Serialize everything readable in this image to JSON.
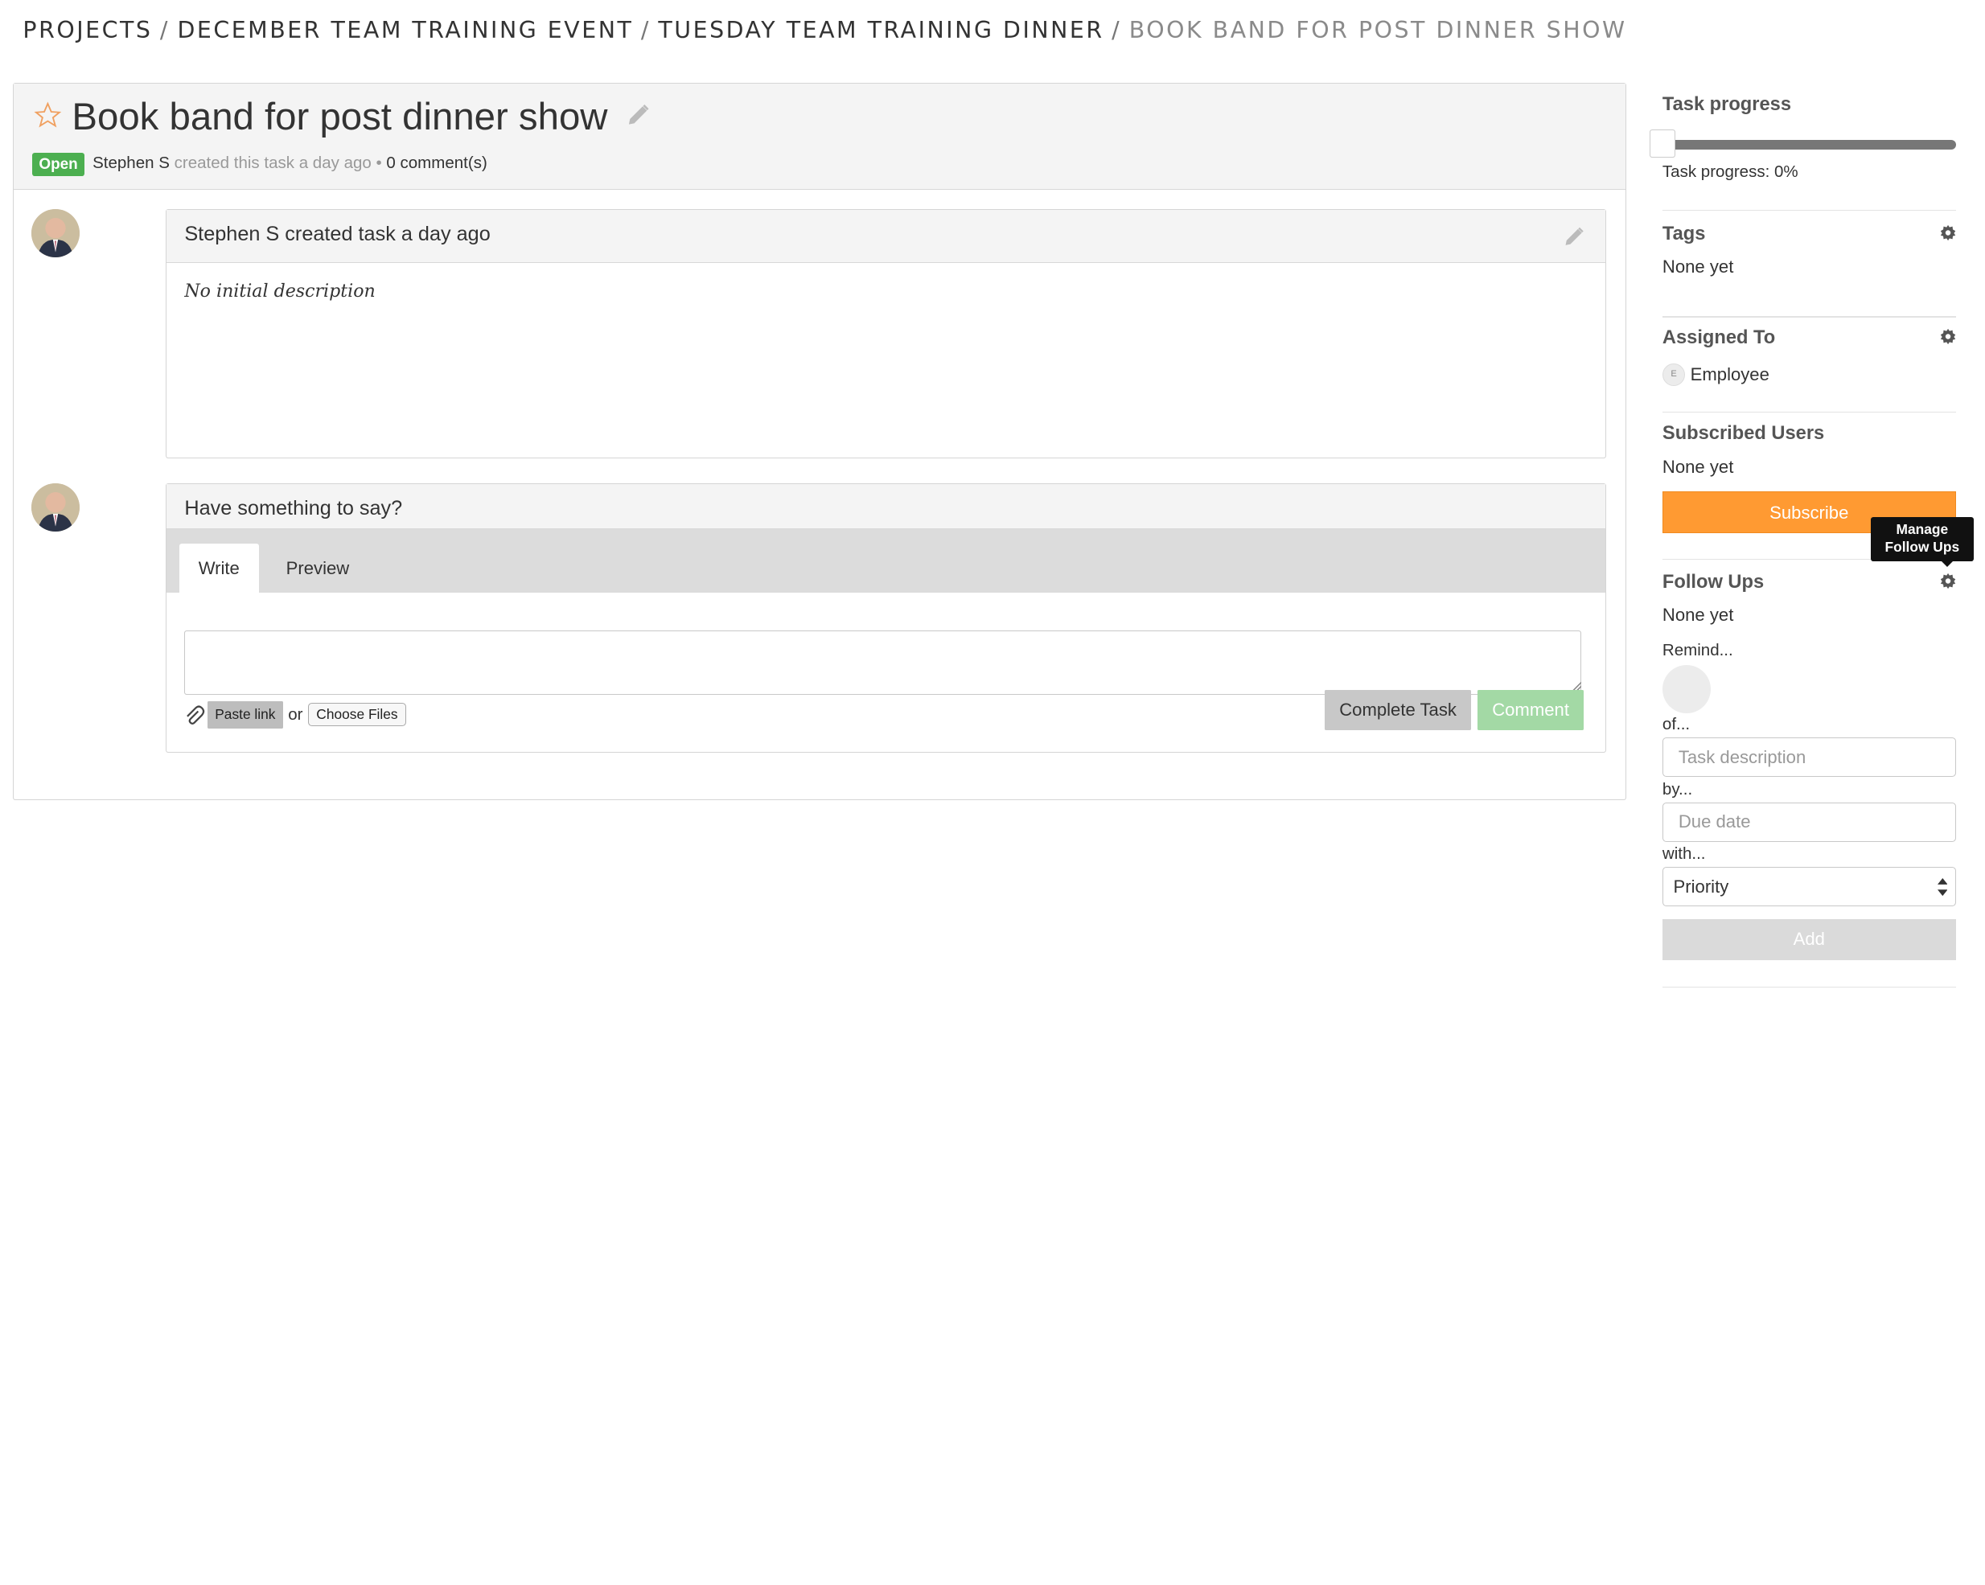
{
  "breadcrumb": {
    "items": [
      "PROJECTS",
      "DECEMBER TEAM TRAINING EVENT",
      "TUESDAY TEAM TRAINING DINNER"
    ],
    "current": "BOOK BAND FOR POST DINNER SHOW",
    "separator": "/"
  },
  "task": {
    "title": "Book band for post dinner show",
    "status": "Open",
    "author": "Stephen S",
    "created_text": "created this task a day ago",
    "dot": "•",
    "comments": "0 comment(s)"
  },
  "activity": {
    "header": "Stephen S created task a day ago",
    "description": "No initial description"
  },
  "comment_form": {
    "header": "Have something to say?",
    "tabs": [
      "Write",
      "Preview"
    ],
    "active_tab": "Write",
    "paste_link": "Paste link",
    "or": "or",
    "choose_files": "Choose Files",
    "complete_task": "Complete Task",
    "comment": "Comment"
  },
  "sidebar": {
    "progress_title": "Task progress",
    "progress_value": 0,
    "progress_label": "Task progress: 0%",
    "tags_title": "Tags",
    "tags_value": "None yet",
    "assigned_title": "Assigned To",
    "assignee_initial": "E",
    "assignee_name": "Employee",
    "subscribed_title": "Subscribed Users",
    "subscribed_value": "None yet",
    "subscribe_button": "Subscribe",
    "tooltip_line1": "Manage",
    "tooltip_line2": "Follow Ups",
    "followups_title": "Follow Ups",
    "followups_value": "None yet",
    "remind_label": "Remind...",
    "of_label": "of...",
    "task_description_placeholder": "Task description",
    "by_label": "by...",
    "due_date_placeholder": "Due date",
    "with_label": "with...",
    "priority_selected": "Priority",
    "add_button": "Add"
  },
  "colors": {
    "open_badge": "#4caf50",
    "subscribe": "#ff9a32",
    "comment_button": "#a3d9a5",
    "slider_track": "#777777"
  }
}
